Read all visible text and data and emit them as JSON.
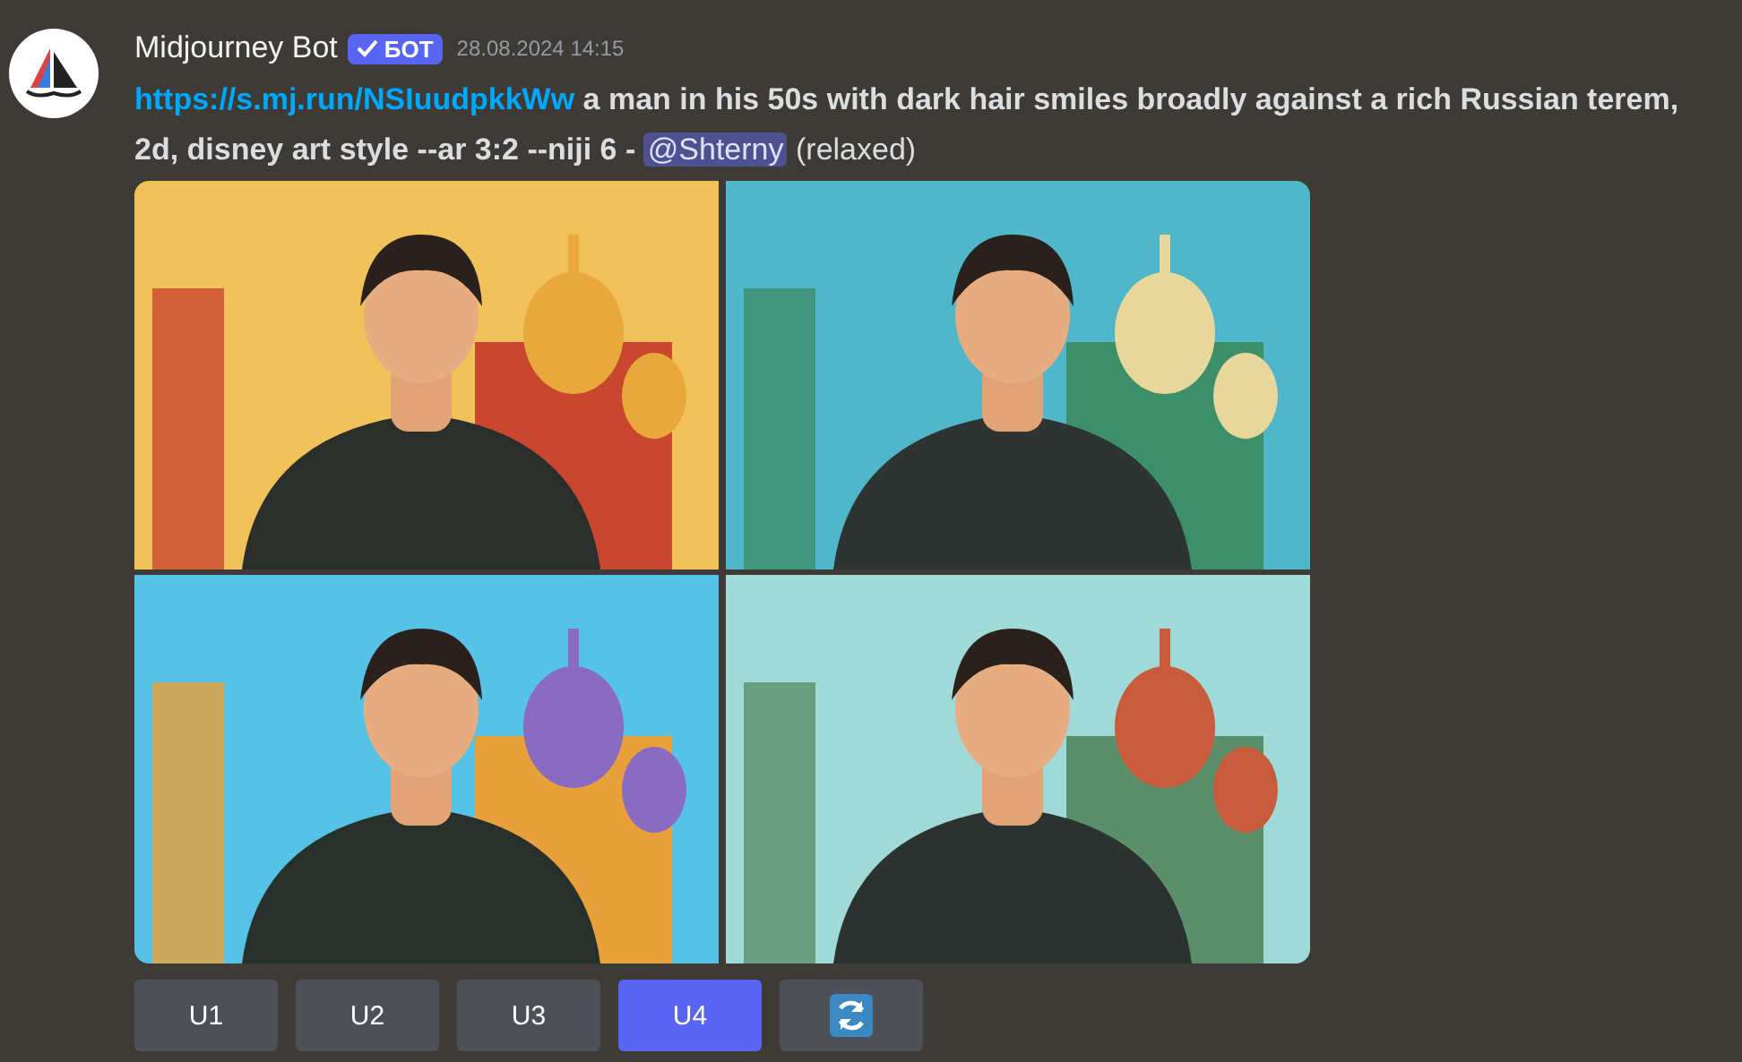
{
  "message": {
    "author": "Midjourney Bot",
    "badge": "БОТ",
    "timestamp": "28.08.2024 14:15",
    "link": "https://s.mj.run/NSIuudpkkWw",
    "prompt": "a man in his 50s with dark hair smiles broadly against a rich Russian terem, 2d, disney art style --ar 3:2 --niji 6",
    "separator": "-",
    "mention": "@Shterny",
    "mode": "(relaxed)",
    "buttons": [
      {
        "kind": "text",
        "label": "U1",
        "selected": false
      },
      {
        "kind": "text",
        "label": "U2",
        "selected": false
      },
      {
        "kind": "text",
        "label": "U3",
        "selected": false
      },
      {
        "kind": "text",
        "label": "U4",
        "selected": true
      },
      {
        "kind": "refresh",
        "selected": false
      }
    ]
  }
}
